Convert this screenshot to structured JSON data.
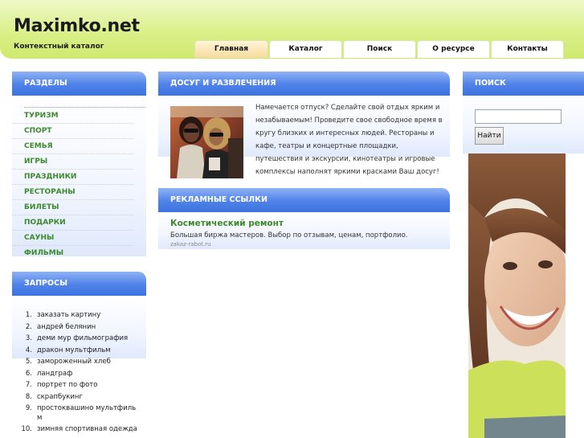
{
  "site": {
    "logo": "Maximko.net",
    "tagline": "Контекстный каталог"
  },
  "nav": [
    {
      "label": "Главная",
      "active": true
    },
    {
      "label": "Каталог",
      "active": false
    },
    {
      "label": "Поиск",
      "active": false
    },
    {
      "label": "О ресурсе",
      "active": false
    },
    {
      "label": "Контакты",
      "active": false
    }
  ],
  "sections": {
    "title": "РАЗДЕЛЫ",
    "items": [
      "ТУРИЗМ",
      "СПОРТ",
      "СЕМЬЯ",
      "ИГРЫ",
      "ПРАЗДНИКИ",
      "РЕСТОРАНЫ",
      "БИЛЕТЫ",
      "ПОДАРКИ",
      "САУНЫ",
      "ФИЛЬМЫ"
    ]
  },
  "queries": {
    "title": "ЗАПРОСЫ",
    "items": [
      {
        "n": "1.",
        "text": "заказать картину"
      },
      {
        "n": "2.",
        "text": "андрей белянин"
      },
      {
        "n": "3.",
        "text": "деми мур фильмография"
      },
      {
        "n": "4.",
        "text": "дракон мультфильм"
      },
      {
        "n": "5.",
        "text": "замороженный хлеб"
      },
      {
        "n": "6.",
        "text": "ландграф"
      },
      {
        "n": "7.",
        "text": "портрет по фото"
      },
      {
        "n": "8.",
        "text": "скрапбукинг"
      },
      {
        "n": "9.",
        "text": "простоквашино мультфиль м"
      },
      {
        "n": "10.",
        "text": "зимняя спортивная одежда"
      }
    ]
  },
  "leisure": {
    "title": "ДОСУГ И РАЗВЛЕЧЕНИЯ",
    "text": "Намечается отпуск? Сделайте свой отдых ярким и незабываемым! Проведите свое свободное время в кругу близких и интересных людей. Рестораны и кафе, театры и концертные площадки, путешествия и экскурсии, кинотеатры и игровые комплексы наполнят яркими красками Ваш досуг!"
  },
  "ads": {
    "title": "РЕКЛАМНЫЕ ССЫЛКИ",
    "link": "Косметический ремонт",
    "desc": "Большая биржа мастеров. Выбор по отзывам, ценам, портфолио.",
    "url": "zakaz-rabot.ru"
  },
  "search": {
    "title": "ПОИСК",
    "value": "",
    "button": "Найти"
  },
  "colors": {
    "header_green": "#d6ee7c",
    "box_blue": "#4f82e8",
    "link_green": "#3b8a2c"
  }
}
